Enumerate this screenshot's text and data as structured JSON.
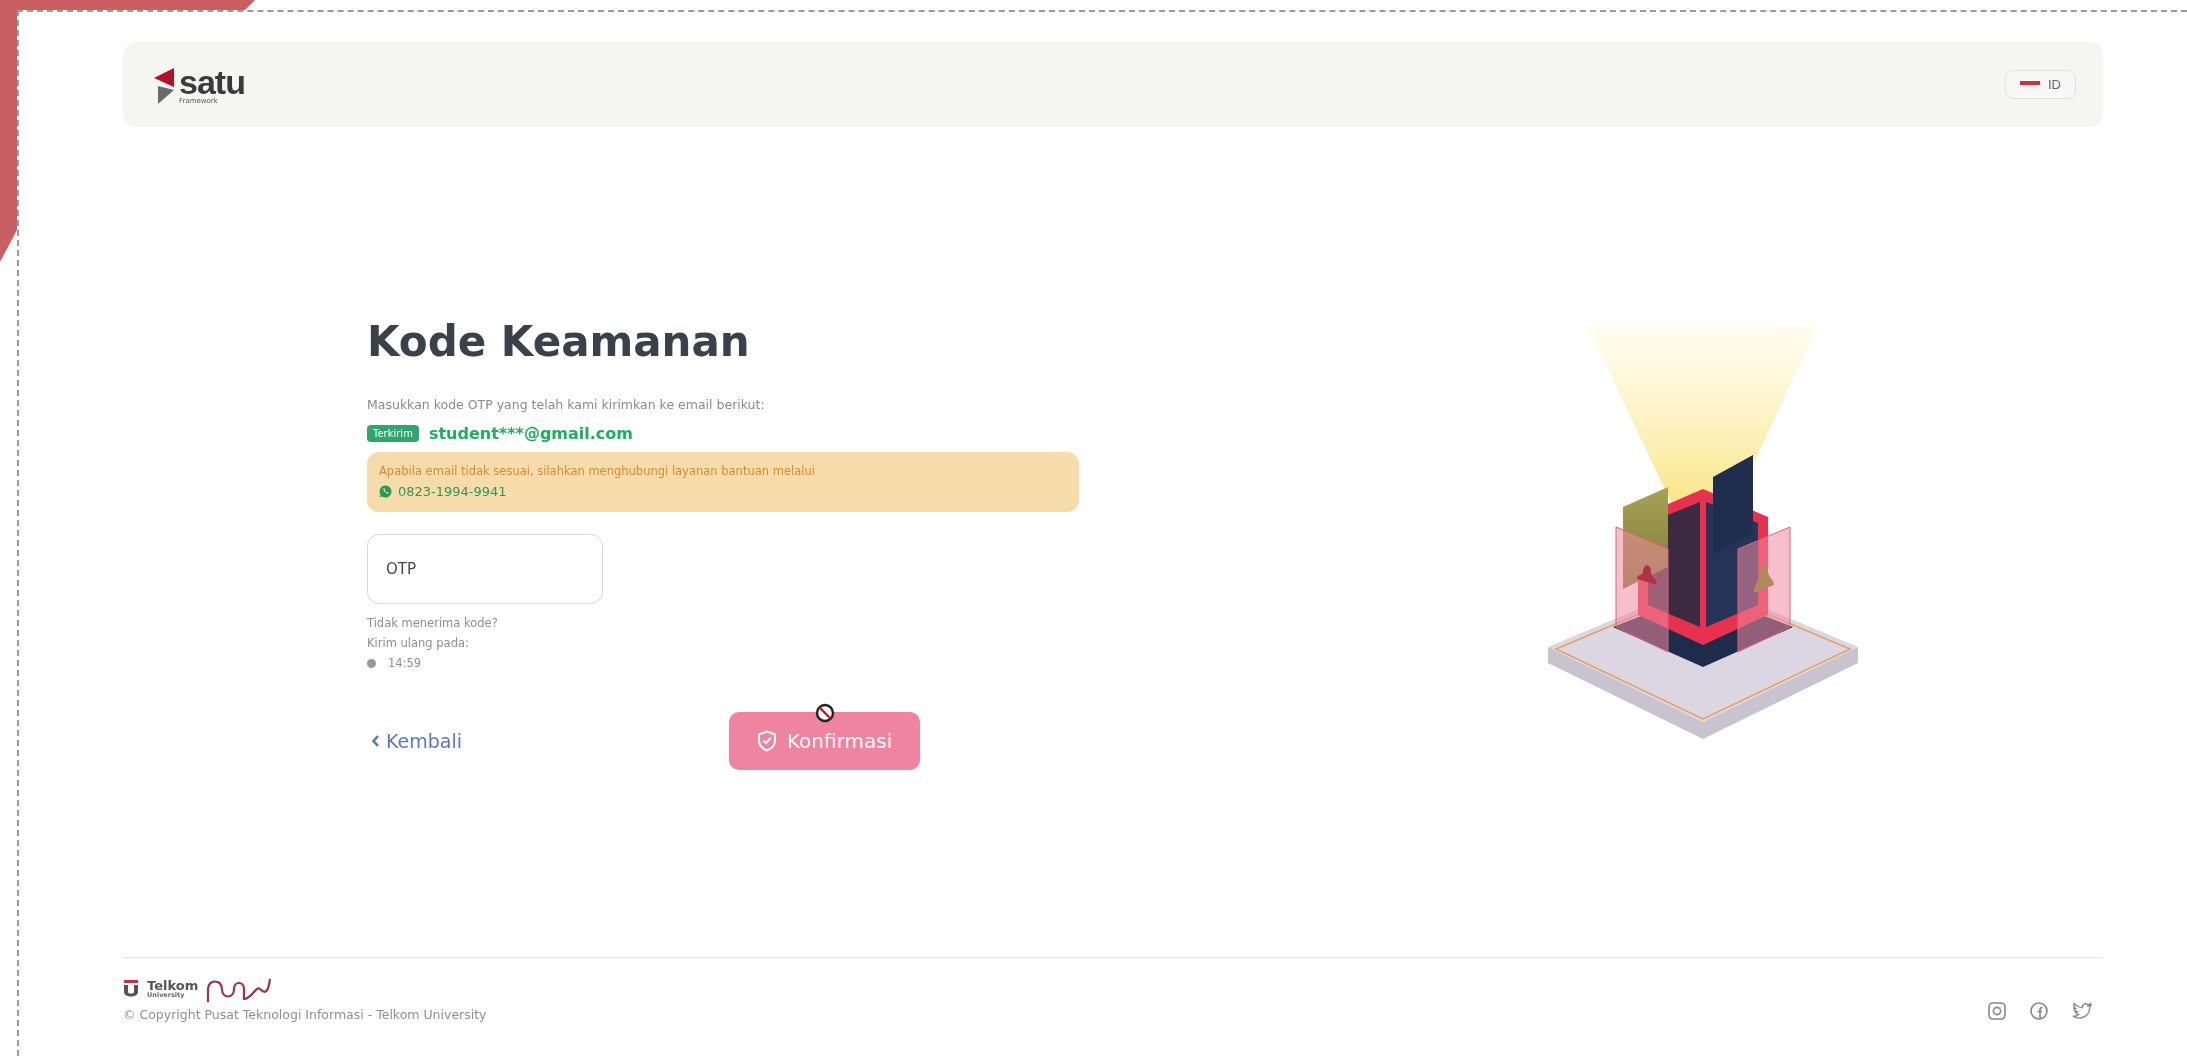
{
  "header": {
    "logo": {
      "name": "satu",
      "tagline": "Framework"
    },
    "language": {
      "code": "ID"
    }
  },
  "form": {
    "title": "Kode Keamanan",
    "instruction": "Masukkan kode OTP yang telah kami kirimkan ke email berikut:",
    "status_badge": "Terkirim",
    "email": "student***@gmail.com",
    "notice": {
      "text": "Apabila email tidak sesuai, silahkan menghubungi layanan bantuan melalui",
      "phone": "0823-1994-9941"
    },
    "otp_field": {
      "placeholder": "OTP"
    },
    "resend": {
      "question": "Tidak menerima kode?",
      "label": "Kirim ulang pada:",
      "timer": "14:59"
    },
    "back_link": "Kembali",
    "confirm_button": {
      "label": "Konfirmasi",
      "disabled": true
    }
  },
  "footer": {
    "logo": {
      "name": "Telkom",
      "subtitle": "University"
    },
    "copyright": "© Copyright Pusat Teknologi Informasi - Telkom University"
  }
}
